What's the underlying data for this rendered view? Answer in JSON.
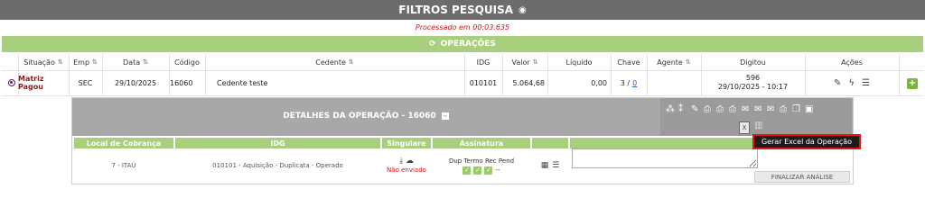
{
  "header": {
    "title": "FILTROS PESQUISA",
    "icon": "eye-slash-icon"
  },
  "processed_text": "Processado em 00:03.635",
  "operations_bar": {
    "label": "OPERAÇÕES",
    "icon": "refresh-icon"
  },
  "table": {
    "columns": {
      "situacao": "Situação",
      "emp": "Emp",
      "data": "Data",
      "codigo": "Código",
      "cedente": "Cedente",
      "idg": "IDG",
      "valor": "Valor",
      "liquido": "Líquido",
      "chave": "Chave",
      "agente": "Agente",
      "digitou": "Digitou",
      "acoes": "Ações"
    },
    "row": {
      "situacao": "Matriz Pagou",
      "emp": "SEC",
      "data": "29/10/2025",
      "codigo": "16060",
      "cedente": "Cedente teste",
      "idg": "010101",
      "valor": "5.064,68",
      "liquido": "0,00",
      "chave_prefix": "3 /",
      "chave_link": "0",
      "digitou_user": "596",
      "digitou_datetime": "29/10/2025 - 10:17"
    }
  },
  "details_panel": {
    "title": "DETALHES DA OPERAÇÃO - 16060",
    "tooltip": "Gerar Excel da Operação",
    "columns": {
      "local": "Local de Cobrança",
      "idg": "IDG",
      "singulare": "Singulare",
      "assinatura": "Assinatura"
    },
    "row": {
      "local": "7 - ITAÚ",
      "idg": "010101 - Aquisição - Duplicata - Operado",
      "singulare_status": "Não enviado",
      "assinatura_labels": "Dup Termo Rec Pend",
      "pend_value": "--"
    },
    "finalize_button": "FINALIZAR ANÁLISE"
  },
  "colors": {
    "accent_green": "#a8cf7d",
    "header_gray": "#6c6c6c",
    "status_red": "#d0121b",
    "situacao_red": "#8b1a1a"
  }
}
